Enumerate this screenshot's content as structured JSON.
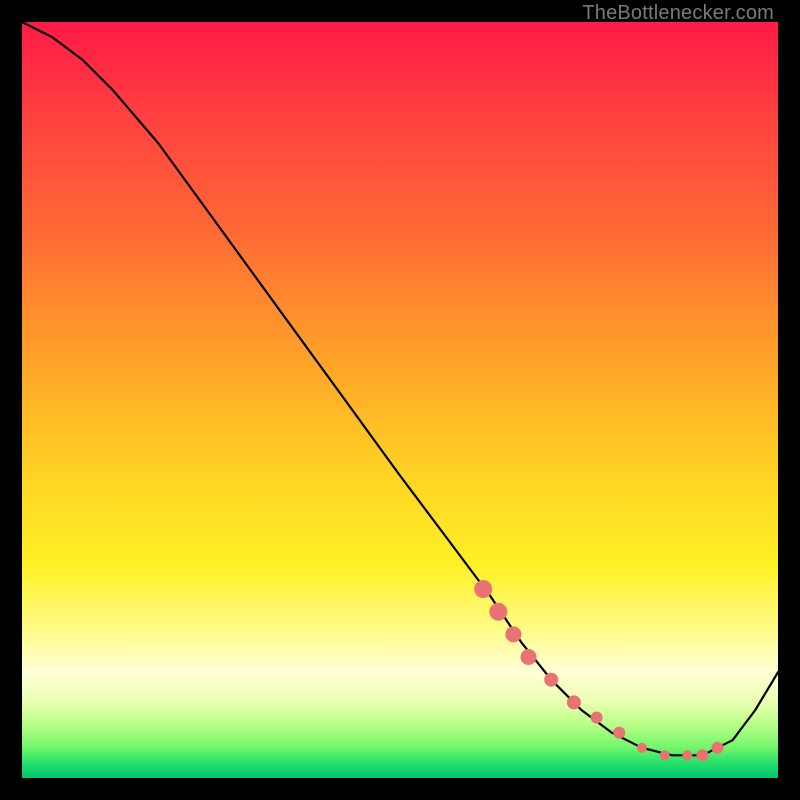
{
  "attribution": "TheBottlenecker.com",
  "chart_data": {
    "type": "line",
    "title": "",
    "xlabel": "",
    "ylabel": "",
    "xlim": [
      0,
      100
    ],
    "ylim": [
      0,
      100
    ],
    "series": [
      {
        "name": "curve",
        "x": [
          0,
          4,
          8,
          12,
          18,
          26,
          34,
          42,
          50,
          56,
          62,
          66,
          70,
          74,
          78,
          82,
          86,
          90,
          94,
          97,
          100
        ],
        "y": [
          100,
          98,
          95,
          91,
          84,
          73,
          62,
          51,
          40,
          32,
          24,
          18,
          13,
          9,
          6,
          4,
          3,
          3,
          5,
          9,
          14
        ]
      }
    ],
    "markers": {
      "name": "highlight-dots",
      "x": [
        61,
        63,
        65,
        67,
        70,
        73,
        76,
        79,
        82,
        85,
        88,
        90,
        92
      ],
      "y": [
        25,
        22,
        19,
        16,
        13,
        10,
        8,
        6,
        4,
        3,
        3,
        3,
        4
      ],
      "r": [
        9,
        9,
        8,
        8,
        7,
        7,
        6,
        6,
        5,
        5,
        5,
        6,
        6
      ]
    }
  }
}
